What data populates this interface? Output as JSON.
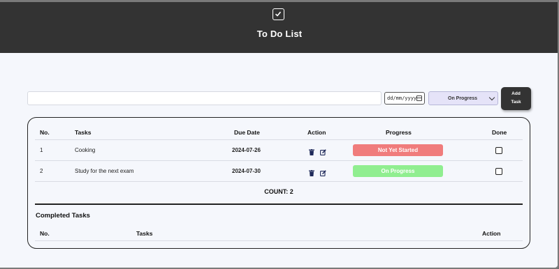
{
  "header": {
    "title": "To Do List",
    "logo_icon": "check-square-icon"
  },
  "form": {
    "task_value": "",
    "date_placeholder": "dd/mm/yyyy",
    "status_selected": "On Progress",
    "add_label_line1": "Add",
    "add_label_line2": "Task"
  },
  "tasks_table": {
    "headers": {
      "no": "No.",
      "tasks": "Tasks",
      "due_date": "Due Date",
      "action": "Action",
      "progress": "Progress",
      "done": "Done"
    },
    "rows": [
      {
        "no": "1",
        "task": "Cooking",
        "due_date": "2024-07-26",
        "progress": "Not Yet Started",
        "progress_color": "#f07c7c",
        "done": false
      },
      {
        "no": "2",
        "task": "Study for the next exam",
        "due_date": "2024-07-30",
        "progress": "On Progress",
        "progress_color": "#90ee90",
        "done": false
      }
    ],
    "count_label": "COUNT: 2",
    "action_icons": [
      "trash-icon",
      "edit-icon"
    ]
  },
  "completed": {
    "title": "Completed Tasks",
    "headers": {
      "no": "No.",
      "tasks": "Tasks",
      "action": "Action"
    },
    "rows": []
  },
  "colors": {
    "header_bg": "#333333",
    "page_bg": "#f5f7fc",
    "icon_color": "#1f2a5a",
    "select_bg": "#e5e3f8"
  }
}
